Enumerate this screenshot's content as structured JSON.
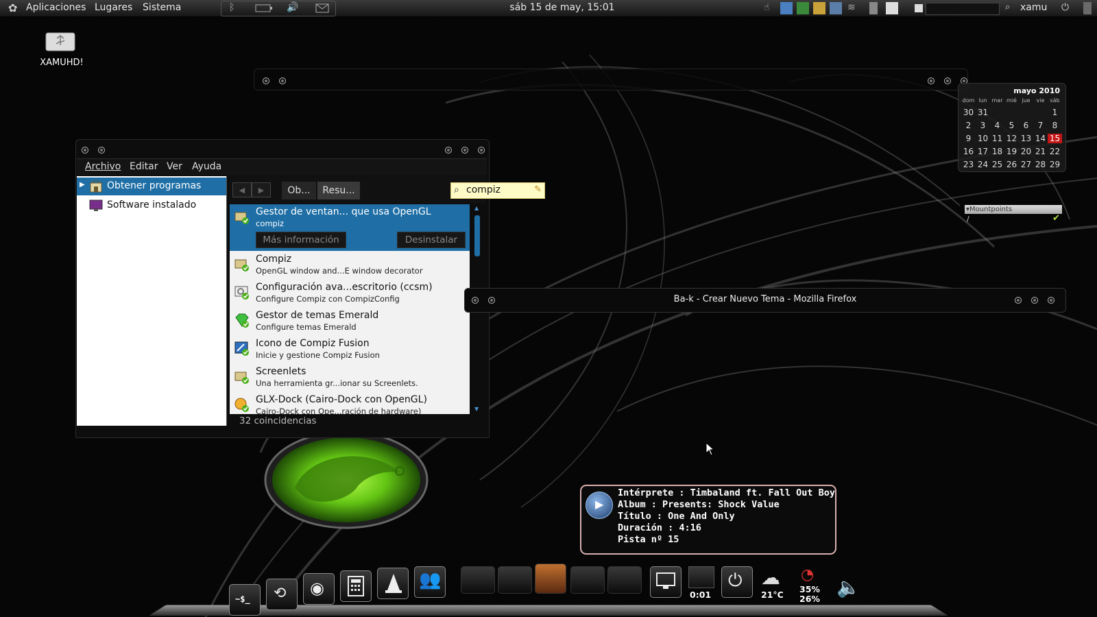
{
  "top_panel": {
    "menus": [
      "Aplicaciones",
      "Lugares",
      "Sistema"
    ],
    "clock": "sáb 15 de may, 15:01",
    "user": "xamu"
  },
  "desktop": {
    "drive_label": "XAMUHD!"
  },
  "software_center": {
    "menu": [
      "Archivo",
      "Editar",
      "Ver",
      "Ayuda"
    ],
    "sidebar": [
      {
        "label": "Obtener programas",
        "selected": true
      },
      {
        "label": "Software instalado",
        "selected": false
      }
    ],
    "breadcrumbs": [
      "Ob...",
      "Resu..."
    ],
    "search_value": "compiz",
    "results": [
      {
        "title": "Gestor de ventan... que usa OpenGL",
        "subtitle": "compiz",
        "icon": "package-icon"
      },
      {
        "title": "Compiz",
        "subtitle": "OpenGL window and...E window decorator",
        "icon": "package-icon"
      },
      {
        "title": "Configuración ava...escritorio (ccsm)",
        "subtitle": "Configure Compiz con CompizConfig",
        "icon": "settings-icon"
      },
      {
        "title": "Gestor de temas Emerald",
        "subtitle": "Configure temas Emerald",
        "icon": "emerald-icon"
      },
      {
        "title": "Icono de Compiz Fusion",
        "subtitle": "Inicie y gestione Compiz Fusion",
        "icon": "fusion-icon"
      },
      {
        "title": "Screenlets",
        "subtitle": "Una herramienta gr...ionar su Screenlets.",
        "icon": "package-icon"
      },
      {
        "title": "GLX-Dock (Cairo-Dock con OpenGL)",
        "subtitle": "Cairo-Dock con Ope...ración de hardware)",
        "icon": "dock-icon"
      }
    ],
    "more_info_label": "Más información",
    "uninstall_label": "Desinstalar",
    "status": "32 coincidencias"
  },
  "calendar": {
    "month": "mayo 2010",
    "days_of_week": [
      "dom",
      "lun",
      "mar",
      "mié",
      "jue",
      "vie",
      "sáb"
    ],
    "weeks": [
      [
        "30",
        "31",
        "",
        "",
        "",
        "",
        "1"
      ],
      [
        "2",
        "3",
        "4",
        "5",
        "6",
        "7",
        "8"
      ],
      [
        "9",
        "10",
        "11",
        "12",
        "13",
        "14",
        "15"
      ],
      [
        "16",
        "17",
        "18",
        "19",
        "20",
        "21",
        "22"
      ],
      [
        "23",
        "24",
        "25",
        "26",
        "27",
        "28",
        "29"
      ]
    ],
    "today": "15",
    "today_color": "#c41616"
  },
  "mountpoints": {
    "title": "▾Mountpoints",
    "entry": "/"
  },
  "firefox_window": {
    "title": "Ba-k - Crear Nuevo Tema - Mozilla Firefox"
  },
  "music_tooltip": {
    "lines": [
      "Intérprete : Timbaland ft. Fall Out Boy",
      "Album : Presents: Shock Value",
      "Título : One And Only",
      "Duración : 4:16",
      "Pista nº 15"
    ]
  },
  "dock": {
    "terminal_label": "~$_",
    "player_time": "0:01",
    "weather_temp": "21°C",
    "cpu_percent": "35%",
    "ram_percent": "26%"
  },
  "colors": {
    "selection": "#1f6fa6",
    "search_bg": "#fffbc7"
  }
}
